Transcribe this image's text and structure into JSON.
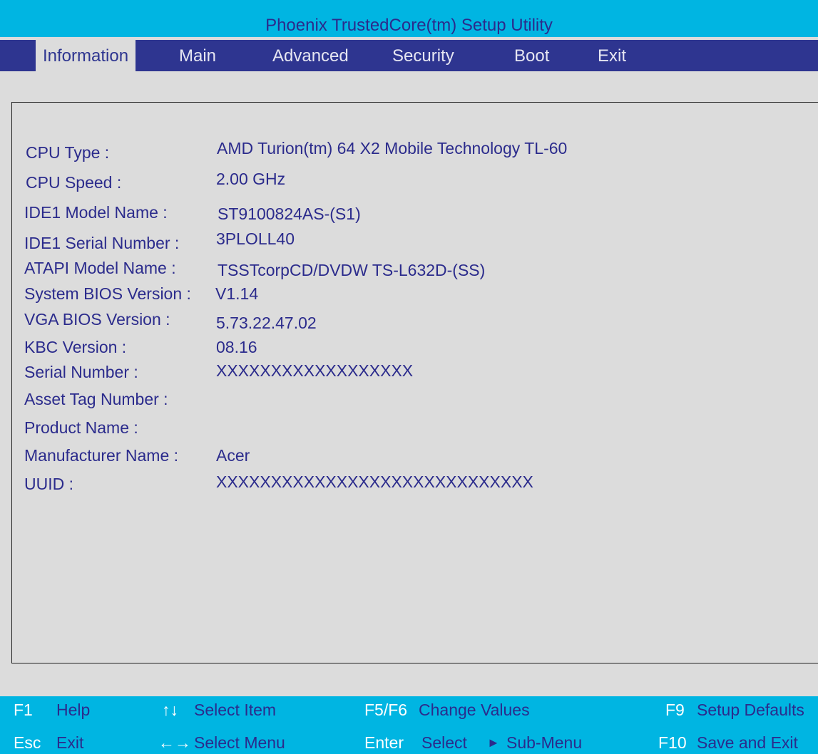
{
  "title": "Phoenix TrustedCore(tm) Setup Utility",
  "menu": {
    "items": [
      "Information",
      "Main",
      "Advanced",
      "Security",
      "Boot",
      "Exit"
    ],
    "selected": "Information"
  },
  "info": [
    {
      "label": "CPU Type :",
      "value": "AMD Turion(tm) 64 X2 Mobile Technology TL-60"
    },
    {
      "label": "CPU Speed :",
      "value": "2.00 GHz"
    },
    {
      "label": "IDE1 Model Name :",
      "value": "ST9100824AS-(S1)"
    },
    {
      "label": "IDE1 Serial Number :",
      "value": "3PLOLL40"
    },
    {
      "label": "ATAPI Model Name :",
      "value": "TSSTcorpCD/DVDW TS-L632D-(SS)"
    },
    {
      "label": "System BIOS Version :",
      "value": "V1.14"
    },
    {
      "label": "VGA BIOS Version :",
      "value": "5.73.22.47.02"
    },
    {
      "label": "KBC Version :",
      "value": "08.16"
    },
    {
      "label": "Serial Number :",
      "value": "XXXXXXXXXXXXXXXXXX"
    },
    {
      "label": "Asset Tag Number :",
      "value": ""
    },
    {
      "label": "Product Name :",
      "value": ""
    },
    {
      "label": "Manufacturer Name :",
      "value": "Acer"
    },
    {
      "label": "UUID :",
      "value": "XXXXXXXXXXXXXXXXXXXXXXXXXXXXX"
    }
  ],
  "status": {
    "f1_key": "F1",
    "f1_desc": "Help",
    "updown_key": "↑↓",
    "updown_desc": "Select Item",
    "f5f6_key": "F5/F6",
    "f5f6_desc": "Change Values",
    "f9_key": "F9",
    "f9_desc": "Setup Defaults",
    "esc_key": "Esc",
    "esc_desc": "Exit",
    "leftright_key": "←→",
    "leftright_desc": "Select Menu",
    "enter_key": "Enter",
    "enter_desc": "Select",
    "submenu_arrow": "►",
    "submenu_desc": "Sub-Menu",
    "f10_key": "F10",
    "f10_desc": "Save and Exit"
  },
  "colors": {
    "title_bg": "#00b5e2",
    "menu_bg": "#2e3590",
    "panel_bg": "#dcdcdc",
    "text": "#2b2b8c",
    "key_text": "#ffffff"
  }
}
